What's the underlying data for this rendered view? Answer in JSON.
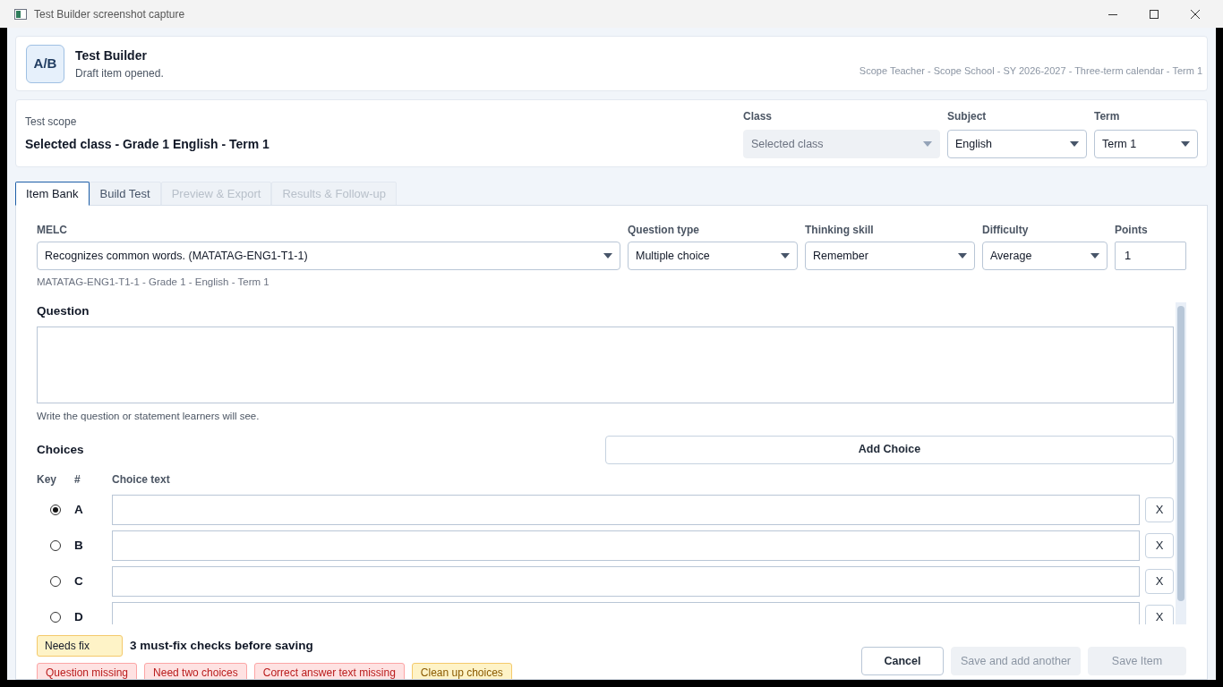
{
  "window": {
    "title": "Test Builder screenshot capture"
  },
  "header": {
    "logo": "A/B",
    "title": "Test Builder",
    "subtitle": "Draft item opened.",
    "context": "Scope Teacher - Scope School - SY 2026-2027 - Three-term calendar - Term 1"
  },
  "scope": {
    "label": "Test scope",
    "value": "Selected class - Grade 1 English - Term 1",
    "selects": [
      {
        "label": "Class",
        "value": "Selected class",
        "disabled": true
      },
      {
        "label": "Subject",
        "value": "English",
        "disabled": false
      },
      {
        "label": "Term",
        "value": "Term 1",
        "disabled": false
      }
    ]
  },
  "tabs": [
    {
      "label": "Item Bank",
      "selected": true,
      "disabled": false
    },
    {
      "label": "Build Test",
      "selected": false,
      "disabled": false
    },
    {
      "label": "Preview & Export",
      "selected": false,
      "disabled": true
    },
    {
      "label": "Results & Follow-up",
      "selected": false,
      "disabled": true
    }
  ],
  "fields": [
    {
      "label": "MELC",
      "value": "Recognizes common words. (MATATAG-ENG1-T1-1)",
      "kind": "select"
    },
    {
      "label": "Question type",
      "value": "Multiple choice",
      "kind": "select"
    },
    {
      "label": "Thinking skill",
      "value": "Remember",
      "kind": "select"
    },
    {
      "label": "Difficulty",
      "value": "Average",
      "kind": "select"
    },
    {
      "label": "Points",
      "value": "1",
      "kind": "input"
    }
  ],
  "melc_hint": "MATATAG-ENG1-T1-1 - Grade 1 - English - Term 1",
  "question": {
    "label": "Question",
    "hint": "Write the question or statement learners will see."
  },
  "choices": {
    "label": "Choices",
    "add_button": "Add Choice",
    "columns": [
      "Key",
      "#",
      "Choice text"
    ],
    "rows": [
      {
        "letter": "A",
        "selected": true,
        "remove": "X"
      },
      {
        "letter": "B",
        "selected": false,
        "remove": "X"
      },
      {
        "letter": "C",
        "selected": false,
        "remove": "X"
      },
      {
        "letter": "D",
        "selected": false,
        "remove": "X"
      }
    ]
  },
  "status": {
    "badge": "Needs fix",
    "summary": "3 must-fix checks before saving",
    "checks": [
      {
        "label": "Question missing",
        "kind": "error"
      },
      {
        "label": "Need two choices",
        "kind": "error"
      },
      {
        "label": "Correct answer text missing",
        "kind": "error"
      },
      {
        "label": "Clean up choices",
        "kind": "warning"
      }
    ]
  },
  "buttons": [
    {
      "label": "Cancel",
      "disabled": false
    },
    {
      "label": "Save and add another",
      "disabled": true
    },
    {
      "label": "Save Item",
      "disabled": true
    }
  ]
}
